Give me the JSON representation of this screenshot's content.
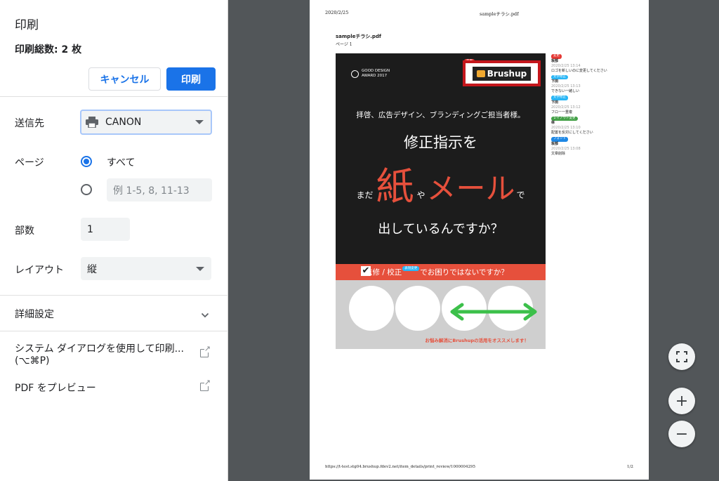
{
  "panel": {
    "title": "印刷",
    "sheets": "印刷総数: 2 枚",
    "cancel": "キャンセル",
    "print": "印刷",
    "destination_label": "送信先",
    "destination_value": "CANON",
    "pages_label": "ページ",
    "pages_all": "すべて",
    "pages_custom_placeholder": "例 1-5, 8, 11-13",
    "copies_label": "部数",
    "copies_value": "1",
    "layout_label": "レイアウト",
    "layout_value": "縦",
    "more_settings": "詳細設定",
    "system_dialog_line1": "システム ダイアログを使用して印刷...",
    "system_dialog_line2": "(⌥⌘P)",
    "pdf_preview": "PDF をプレビュー"
  },
  "preview": {
    "header_date": "2020/2/25",
    "header_title": "sampleチラシ.pdf",
    "doc_name": "sampleチラシ.pdf",
    "doc_page": "ページ 1",
    "footer_url": "https://t-test.stg04.brushup.fdev2.net/item_details/print_review/1000004295",
    "footer_page": "1/2"
  },
  "flyer": {
    "gd_line1": "GOOD DESIGN",
    "gd_line2": "AWARD 2017",
    "logo": "Brushup",
    "logo_tag": "変更",
    "line1": "拝啓、広告デザイン、ブランディングご担当者様。",
    "line2": "修正指示を",
    "mada": "まだ",
    "kami": "紙",
    "ya": "や",
    "mail": "メール",
    "de": "で",
    "line4": "出しているんですか？",
    "band_a": "監修 / 校正",
    "band_tag": "表現変更",
    "band_b": "でお困りではないですか？",
    "cta": "お悩み解消にBrushupの活用をオススメします！"
  },
  "comments": [
    {
      "tag": "変更",
      "color": "#e53935",
      "name": "坂部",
      "date": "2020/2/25 13:14",
      "text": "ロゴを新しいのに変更してください"
    },
    {
      "tag": "文字修正",
      "color": "#29b6f6",
      "name": "下田",
      "date": "2020/2/25 13:13",
      "text": "できない一緒しい"
    },
    {
      "tag": "文字修正",
      "color": "#29b6f6",
      "name": "下田",
      "date": "2020/2/25 13:12",
      "text": "フロー一重複"
    },
    {
      "tag": "レイアウト変更",
      "color": "#43a047",
      "name": "林",
      "date": "2020/2/25 13:10",
      "text": "配置を反対にしてください"
    },
    {
      "tag": "フォント",
      "color": "#1e88e5",
      "name": "坂部",
      "date": "2020/2/25 13:08",
      "text": "文章削除"
    }
  ]
}
